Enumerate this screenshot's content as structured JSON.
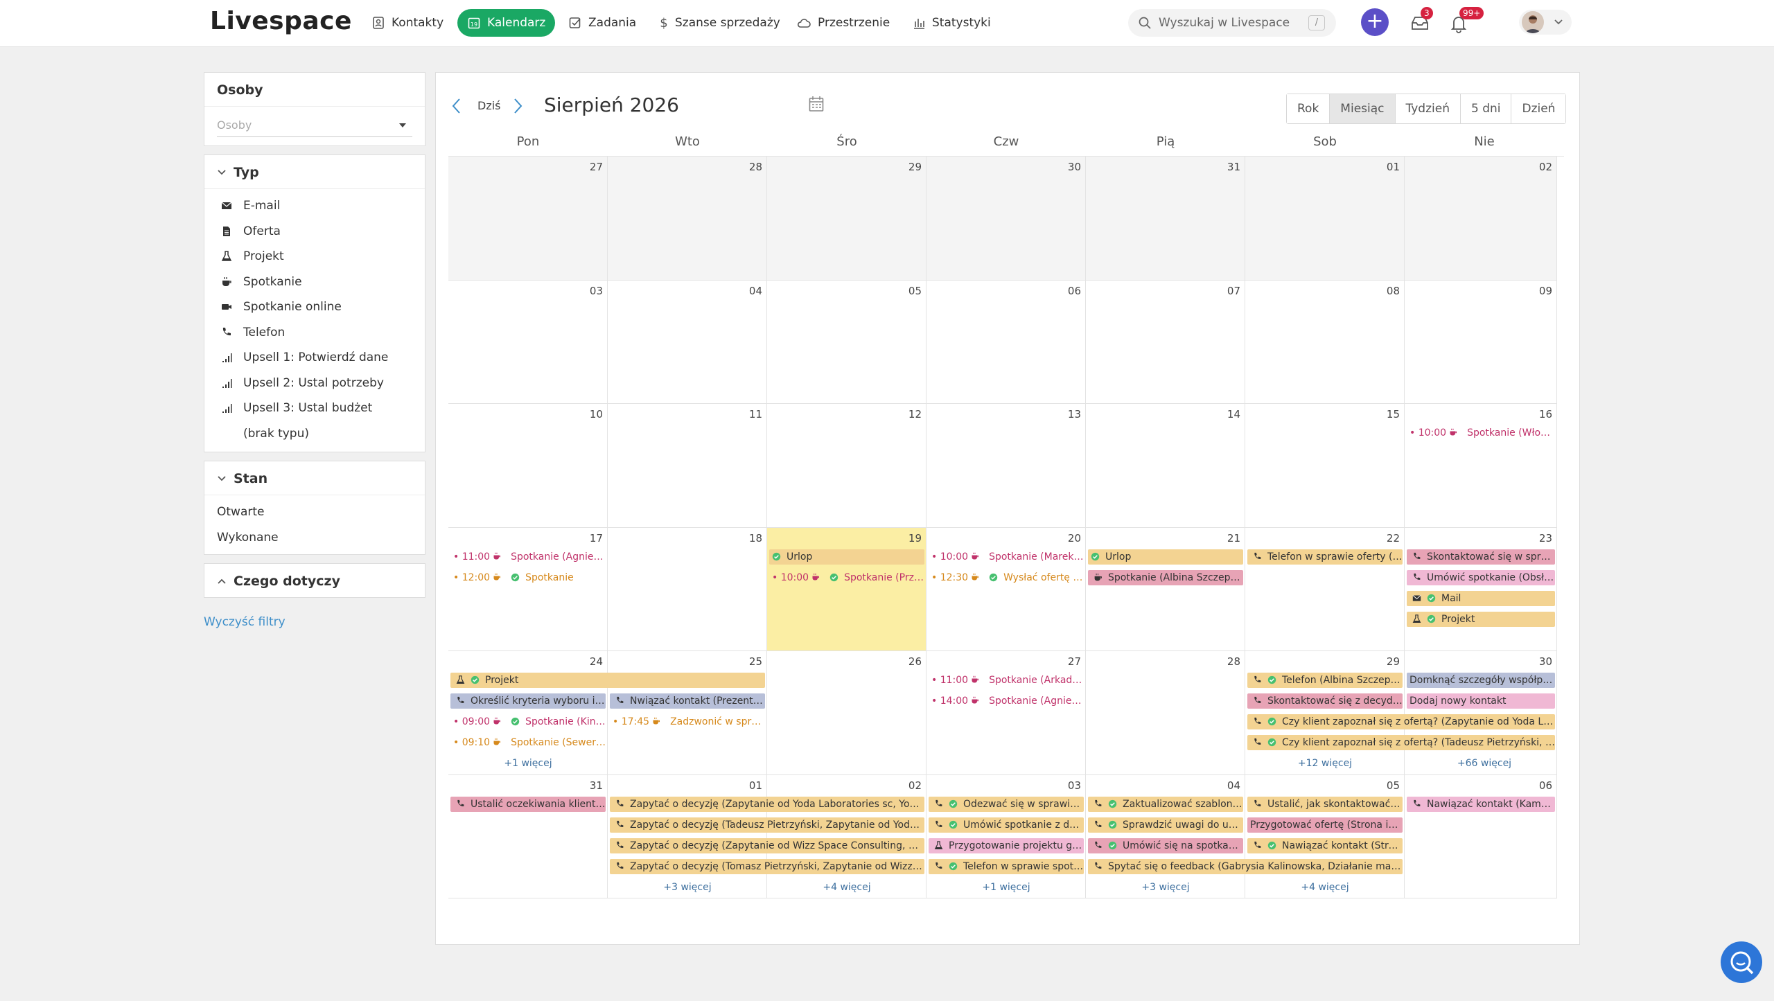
{
  "app": {
    "logo": "Livespace"
  },
  "nav": [
    {
      "label": "Kontakty",
      "icon": "contacts-icon"
    },
    {
      "label": "Kalendarz",
      "icon": "calendar-icon",
      "active": true
    },
    {
      "label": "Zadania",
      "icon": "tasks-icon"
    },
    {
      "label": "Szanse sprzedaży",
      "icon": "dollar-icon"
    },
    {
      "label": "Przestrzenie",
      "icon": "cloud-icon"
    },
    {
      "label": "Statystyki",
      "icon": "stats-icon"
    }
  ],
  "search": {
    "placeholder": "Wyszukaj w Livespace",
    "shortcut": "/"
  },
  "header_badges": {
    "inbox": "3",
    "notifications": "99+"
  },
  "sidebar": {
    "people": {
      "title": "Osoby",
      "placeholder": "Osoby"
    },
    "type": {
      "title": "Typ",
      "items": [
        {
          "label": "E-mail",
          "icon": "envelope-icon"
        },
        {
          "label": "Oferta",
          "icon": "document-icon"
        },
        {
          "label": "Projekt",
          "icon": "flask-icon"
        },
        {
          "label": "Spotkanie",
          "icon": "coffee-icon"
        },
        {
          "label": "Spotkanie online",
          "icon": "video-icon"
        },
        {
          "label": "Telefon",
          "icon": "phone-icon"
        },
        {
          "label": "Upsell 1: Potwierdź dane",
          "icon": "signal-icon"
        },
        {
          "label": "Upsell 2: Ustal potrzeby",
          "icon": "signal-icon"
        },
        {
          "label": "Upsell 3: Ustal budżet",
          "icon": "signal-icon"
        },
        {
          "label": "(brak typu)",
          "icon": ""
        }
      ]
    },
    "state": {
      "title": "Stan",
      "items": [
        "Otwarte",
        "Wykonane"
      ]
    },
    "concerns": {
      "title": "Czego dotyczy"
    },
    "clear": "Wyczyść filtry"
  },
  "calendar": {
    "today_label": "Dziś",
    "month_title": "Sierpień 2026",
    "views": [
      "Rok",
      "Miesiąc",
      "Tydzień",
      "5 dni",
      "Dzień"
    ],
    "selected_view": "Miesiąc",
    "weekdays": [
      "Pon",
      "Wto",
      "Śro",
      "Czw",
      "Pią",
      "Sob",
      "Nie"
    ],
    "weeks": [
      [
        "27",
        "28",
        "29",
        "30",
        "31",
        "01",
        "02"
      ],
      [
        "03",
        "04",
        "05",
        "06",
        "07",
        "08",
        "09"
      ],
      [
        "10",
        "11",
        "12",
        "13",
        "14",
        "15",
        "16"
      ],
      [
        "17",
        "18",
        "19",
        "20",
        "21",
        "22",
        "23"
      ],
      [
        "24",
        "25",
        "26",
        "27",
        "28",
        "29",
        "30"
      ],
      [
        "31",
        "01",
        "02",
        "03",
        "04",
        "05",
        "06"
      ]
    ],
    "past_cells": [
      [
        0,
        0
      ],
      [
        0,
        1
      ],
      [
        0,
        2
      ],
      [
        0,
        3
      ],
      [
        0,
        4
      ],
      [
        0,
        5
      ],
      [
        0,
        6
      ]
    ],
    "today_cell": [
      3,
      2
    ],
    "events": [
      {
        "w": 2,
        "d": 6,
        "row": 0,
        "kind": "dot",
        "color": "pink",
        "time": "10:00",
        "text": "Spotkanie (Włodzimi..."
      },
      {
        "w": 3,
        "d": 0,
        "row": 0,
        "kind": "dot",
        "color": "pink",
        "time": "11:00",
        "text": "Spotkanie (Agnieszk..."
      },
      {
        "w": 3,
        "d": 0,
        "row": 1,
        "kind": "dot",
        "color": "orange",
        "time": "12:00",
        "done": true,
        "text": "Spotkanie"
      },
      {
        "w": 3,
        "d": 2,
        "row": 0,
        "kind": "bar",
        "color": "#f3d392",
        "done": true,
        "text": "Urlop"
      },
      {
        "w": 3,
        "d": 2,
        "row": 1,
        "kind": "dot",
        "color": "pink",
        "time": "10:00",
        "done": true,
        "text": "Spotkanie (Prze..."
      },
      {
        "w": 3,
        "d": 3,
        "row": 0,
        "kind": "dot",
        "color": "pink",
        "time": "10:00",
        "text": "Spotkanie (Marek Pa..."
      },
      {
        "w": 3,
        "d": 3,
        "row": 1,
        "kind": "dot",
        "color": "orange",
        "time": "12:30",
        "done": true,
        "text": "Wysłać ofertę (Se..."
      },
      {
        "w": 3,
        "d": 4,
        "row": 0,
        "kind": "bar",
        "color": "#f3d392",
        "done": true,
        "text": "Urlop"
      },
      {
        "w": 3,
        "d": 4,
        "row": 1,
        "kind": "bar",
        "color": "#e7a3b5",
        "text": "Spotkanie (Albina Szczepańs..."
      },
      {
        "w": 3,
        "d": 5,
        "row": 0,
        "kind": "bar",
        "color": "#f3d392",
        "text": "Telefon w sprawie oferty (Ju..."
      },
      {
        "w": 3,
        "d": 6,
        "row": 0,
        "kind": "bar",
        "color": "#e7a3b5",
        "text": "Skontaktować się w sprawie spo..."
      },
      {
        "w": 3,
        "d": 6,
        "row": 1,
        "kind": "bar",
        "color": "#f0b8d4",
        "text": "Umówić spotkanie (Obsługa ..."
      },
      {
        "w": 3,
        "d": 6,
        "row": 2,
        "kind": "bar",
        "color": "#f3d392",
        "done": true,
        "text": "Mail"
      },
      {
        "w": 3,
        "d": 6,
        "row": 3,
        "kind": "bar",
        "color": "#f3d392",
        "done": true,
        "text": "Projekt"
      },
      {
        "w": 4,
        "d": 0,
        "row": 0,
        "span": 2,
        "kind": "bar",
        "color": "#f3d392",
        "done": true,
        "text": "Projekt"
      },
      {
        "w": 4,
        "d": 0,
        "row": 1,
        "kind": "bar",
        "color": "#b7bfd8",
        "text": "Określić kryteria wyboru i bu..."
      },
      {
        "w": 4,
        "d": 0,
        "row": 2,
        "kind": "dot",
        "color": "pink",
        "time": "09:00",
        "done": true,
        "text": "Spotkanie (Kinga..."
      },
      {
        "w": 4,
        "d": 0,
        "row": 3,
        "kind": "dot",
        "color": "orange",
        "time": "09:10",
        "text": "Spotkanie (Seweryn..."
      },
      {
        "w": 4,
        "d": 1,
        "row": 1,
        "kind": "bar",
        "color": "#b7bfd8",
        "text": "Nwiązać kontakt (Prezentacj..."
      },
      {
        "w": 4,
        "d": 1,
        "row": 2,
        "kind": "dot",
        "color": "orange",
        "time": "17:45",
        "text": "Zadzwonić w sprawie..."
      },
      {
        "w": 4,
        "d": 3,
        "row": 0,
        "kind": "dot",
        "color": "pink",
        "time": "11:00",
        "text": "Spotkanie (Arkadius..."
      },
      {
        "w": 4,
        "d": 3,
        "row": 1,
        "kind": "dot",
        "color": "pink",
        "time": "14:00",
        "text": "Spotkanie (Agnieszk..."
      },
      {
        "w": 4,
        "d": 5,
        "row": 0,
        "kind": "bar",
        "color": "#f3d392",
        "done": true,
        "text": "Telefon (Albina Szczepań..."
      },
      {
        "w": 4,
        "d": 5,
        "row": 1,
        "kind": "bar",
        "color": "#e7a3b5",
        "text": "Skontaktować się z decydent..."
      },
      {
        "w": 4,
        "d": 5,
        "row": 2,
        "span": 2,
        "kind": "bar",
        "color": "#f3d392",
        "done": true,
        "text": "Czy klient zapoznał się z ofertą? (Zapytanie od Yoda Laborator..."
      },
      {
        "w": 4,
        "d": 5,
        "row": 3,
        "span": 2,
        "kind": "bar",
        "color": "#f3d392",
        "done": true,
        "text": "Czy klient zapoznał się z ofertą? (Tadeusz Pietrzyński, Zapytan..."
      },
      {
        "w": 4,
        "d": 6,
        "row": 0,
        "kind": "bar",
        "color": "#b7bfd8",
        "text": "Domknąć szczegóły współpracy ..."
      },
      {
        "w": 4,
        "d": 6,
        "row": 1,
        "kind": "bar",
        "color": "#f0b8d4",
        "text": "Dodaj nowy kontakt"
      },
      {
        "w": 5,
        "d": 0,
        "row": 0,
        "kind": "bar",
        "color": "#e7a3b5",
        "text": "Ustalić oczekiwania klienta (Pre..."
      },
      {
        "w": 5,
        "d": 1,
        "row": 0,
        "span": 2,
        "kind": "bar",
        "color": "#f3d392",
        "text": "Zapytać o decyzję (Zapytanie od Yoda Laboratories sc, Yoda Labor..."
      },
      {
        "w": 5,
        "d": 1,
        "row": 1,
        "span": 2,
        "kind": "bar",
        "color": "#f3d392",
        "text": "Zapytać o decyzję (Tadeusz Pietrzyński, Zapytanie od Yoda Corp L..."
      },
      {
        "w": 5,
        "d": 1,
        "row": 2,
        "span": 2,
        "kind": "bar",
        "color": "#f3d392",
        "text": "Zapytać o decyzję (Zapytanie od Wizz Space Consulting, Wizz Spa..."
      },
      {
        "w": 5,
        "d": 1,
        "row": 3,
        "span": 2,
        "kind": "bar",
        "color": "#f3d392",
        "text": "Zapytać o decyzję (Tomasz Pietrzyński, Zapytanie od Wizz Soft sc, ..."
      },
      {
        "w": 5,
        "d": 3,
        "row": 0,
        "kind": "bar",
        "color": "#f3d392",
        "done": true,
        "text": "Odezwać się w sprawie prze..."
      },
      {
        "w": 5,
        "d": 3,
        "row": 1,
        "kind": "bar",
        "color": "#f3d392",
        "done": true,
        "text": "Umówić spotkanie z decyde..."
      },
      {
        "w": 5,
        "d": 3,
        "row": 2,
        "kind": "bar",
        "color": "#f0b8d4",
        "text": "Przygotowanie projektu graf..."
      },
      {
        "w": 5,
        "d": 3,
        "row": 3,
        "kind": "bar",
        "color": "#f3d392",
        "done": true,
        "text": "Telefon w sprawie spotk..."
      },
      {
        "w": 5,
        "d": 4,
        "row": 0,
        "kind": "bar",
        "color": "#f3d392",
        "done": true,
        "text": "Zaktualizować szablon oferty"
      },
      {
        "w": 5,
        "d": 4,
        "row": 1,
        "kind": "bar",
        "color": "#f3d392",
        "done": true,
        "text": "Sprawdzić uwagi do umowy ..."
      },
      {
        "w": 5,
        "d": 4,
        "row": 2,
        "kind": "bar",
        "color": "#e7a3b5",
        "done": true,
        "text": "Umówić się na spotkanie (Al..."
      },
      {
        "w": 5,
        "d": 4,
        "row": 3,
        "span": 2,
        "kind": "bar",
        "color": "#f3d392",
        "text": "Spytać się o feedback (Gabrysia Kalinowska, Działanie marketingo..."
      },
      {
        "w": 5,
        "d": 5,
        "row": 0,
        "kind": "bar",
        "color": "#f3d392",
        "text": "Ustalić, jak skontaktować się z d..."
      },
      {
        "w": 5,
        "d": 5,
        "row": 1,
        "kind": "bar",
        "color": "#e7a3b5",
        "text": "Przygotować ofertę (Strona inte..."
      },
      {
        "w": 5,
        "d": 5,
        "row": 2,
        "kind": "bar",
        "color": "#f3d392",
        "done": true,
        "text": "Nawiązać kontakt (Stron..."
      },
      {
        "w": 5,
        "d": 6,
        "row": 0,
        "kind": "bar",
        "color": "#f0b8d4",
        "text": "Nawiązać kontakt (Kampania..."
      }
    ],
    "more": [
      {
        "w": 4,
        "d": 0,
        "text": "+1 więcej"
      },
      {
        "w": 4,
        "d": 5,
        "text": "+12 więcej"
      },
      {
        "w": 4,
        "d": 6,
        "text": "+66 więcej"
      },
      {
        "w": 5,
        "d": 1,
        "text": "+3 więcej"
      },
      {
        "w": 5,
        "d": 2,
        "text": "+4 więcej"
      },
      {
        "w": 5,
        "d": 3,
        "text": "+1 więcej"
      },
      {
        "w": 5,
        "d": 4,
        "text": "+3 więcej"
      },
      {
        "w": 5,
        "d": 5,
        "text": "+4 więcej"
      }
    ]
  }
}
